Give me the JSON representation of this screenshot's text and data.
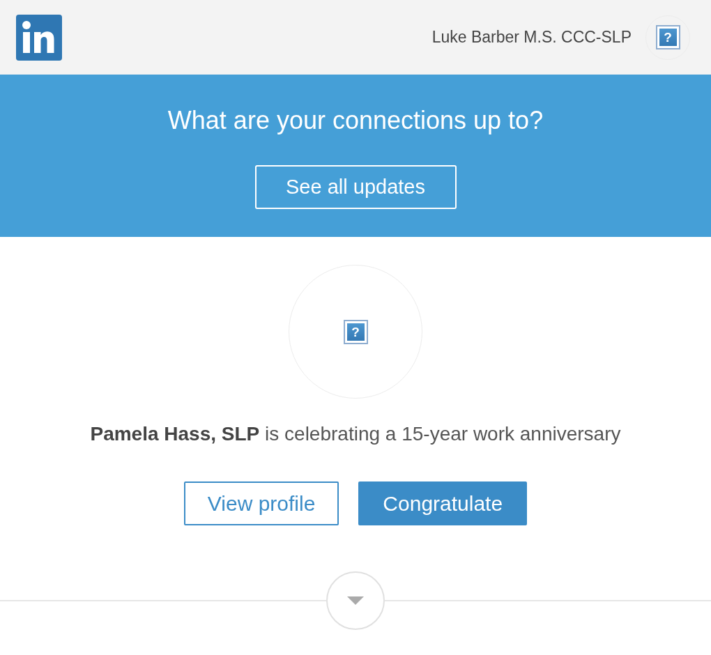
{
  "header": {
    "user_name": "Luke Barber M.S. CCC-SLP",
    "avatar": {
      "kind": "broken_image",
      "glyph": "?"
    }
  },
  "banner": {
    "title": "What are your connections up to?",
    "button": "See all updates"
  },
  "update": {
    "avatar": {
      "kind": "broken_image",
      "glyph": "?"
    },
    "message": "**Pamela Hass, SLP** is celebrating a 15-year work anniversary",
    "buttons": [
      {
        "label": "View profile",
        "kind": "secondary"
      },
      {
        "label": "Congratulate",
        "kind": "primary"
      }
    ]
  }
}
